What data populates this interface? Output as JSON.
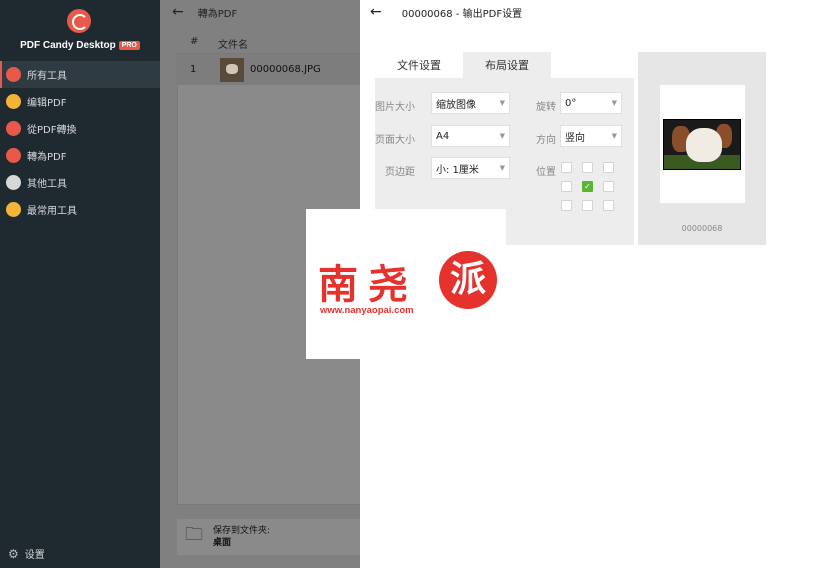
{
  "app": {
    "name": "PDF Candy Desktop",
    "badge": "PRO"
  },
  "sidebar": {
    "items": [
      {
        "label": "所有工具",
        "icon": "candy-icon"
      },
      {
        "label": "编辑PDF",
        "icon": "pen-icon"
      },
      {
        "label": "從PDF轉換",
        "icon": "arrow-down-icon"
      },
      {
        "label": "轉為PDF",
        "icon": "arrow-up-icon"
      },
      {
        "label": "其他工具",
        "icon": "more-icon"
      },
      {
        "label": "最常用工具",
        "icon": "star-icon"
      }
    ],
    "settings_label": "设置"
  },
  "middle": {
    "title": "轉為PDF",
    "col_num": "#",
    "col_name": "文件名",
    "rows": [
      {
        "num": "1",
        "name": "00000068.JPG"
      }
    ],
    "save_label": "保存到文件夾:",
    "save_path": "桌面"
  },
  "dialog": {
    "title": "00000068 - 输出PDF设置",
    "tabs": [
      "文件设置",
      "布局设置"
    ],
    "fields": {
      "image_size_label": "图片大小",
      "image_size_value": "缩放图像",
      "rotate_label": "旋转",
      "rotate_value": "0°",
      "page_size_label": "页面大小",
      "page_size_value": "A4",
      "orientation_label": "方向",
      "orientation_value": "竖向",
      "margin_label": "页边距",
      "margin_value": "小: 1厘米",
      "position_label": "位置"
    },
    "preview_name": "00000068"
  },
  "watermark": {
    "text1": "南",
    "text2": "尧",
    "text3": "派",
    "url": "www.nanyaopai.com"
  },
  "colors": {
    "accent": "#e9594a",
    "sidebar": "#1f2a30",
    "check": "#5cb531"
  }
}
